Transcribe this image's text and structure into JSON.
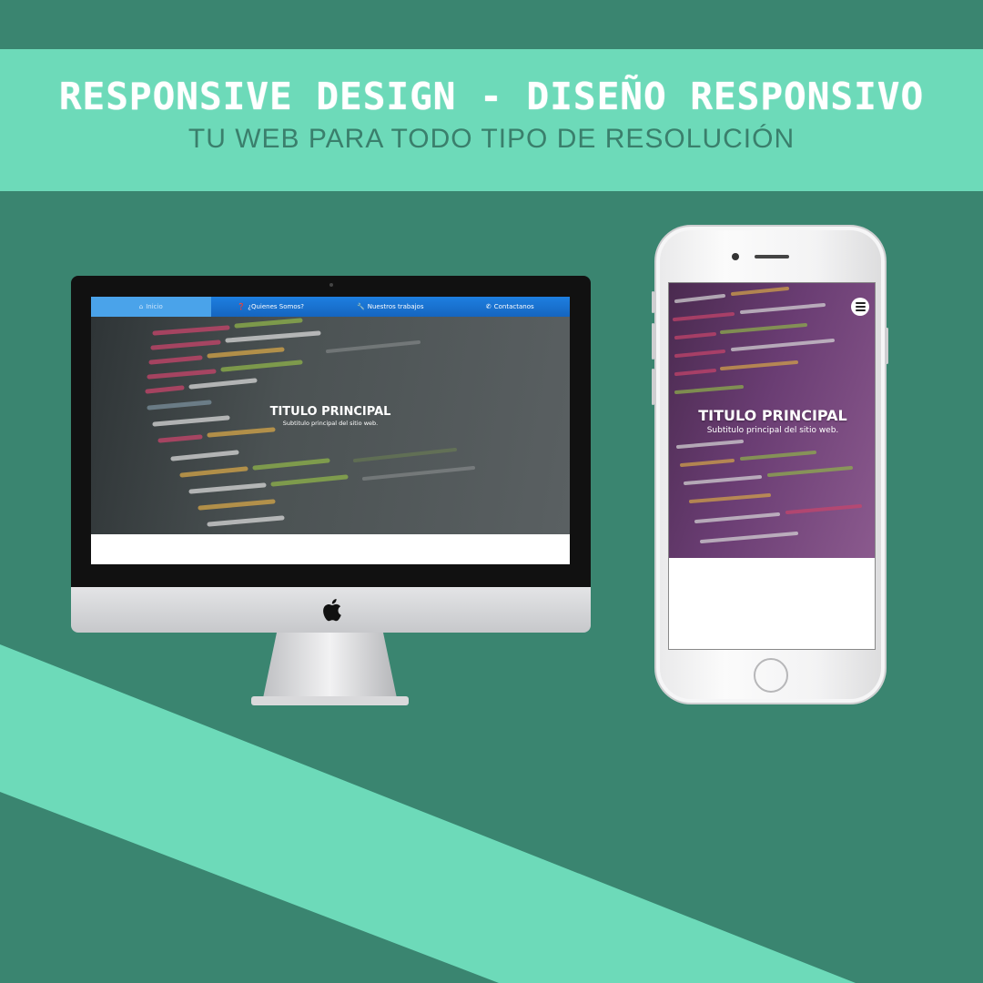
{
  "banner": {
    "title": "RESPONSIVE DESIGN - DISEÑO RESPONSIVO",
    "subtitle": "TU WEB PARA TODO TIPO DE RESOLUCIÓN"
  },
  "desktop": {
    "nav": [
      {
        "icon": "home-icon",
        "glyph": "⌂",
        "label": "Inicio",
        "active": true
      },
      {
        "icon": "question-icon",
        "glyph": "❓",
        "label": "¿Quienes Somos?",
        "active": false
      },
      {
        "icon": "wrench-icon",
        "glyph": "🔧",
        "label": "Nuestros trabajos",
        "active": false
      },
      {
        "icon": "phone-icon",
        "glyph": "✆",
        "label": "Contactanos",
        "active": false
      }
    ],
    "hero_title": "TITULO PRINCIPAL",
    "hero_subtitle": "Subtitulo principal del sitio web."
  },
  "mobile": {
    "hero_title": "TITULO PRINCIPAL",
    "hero_subtitle": "Subtitulo principal del sitio web."
  },
  "colors": {
    "background": "#3a8570",
    "accent": "#6ddab9",
    "nav_blue": "#1e7fe0",
    "subtitle_text": "#3a7f6c"
  }
}
